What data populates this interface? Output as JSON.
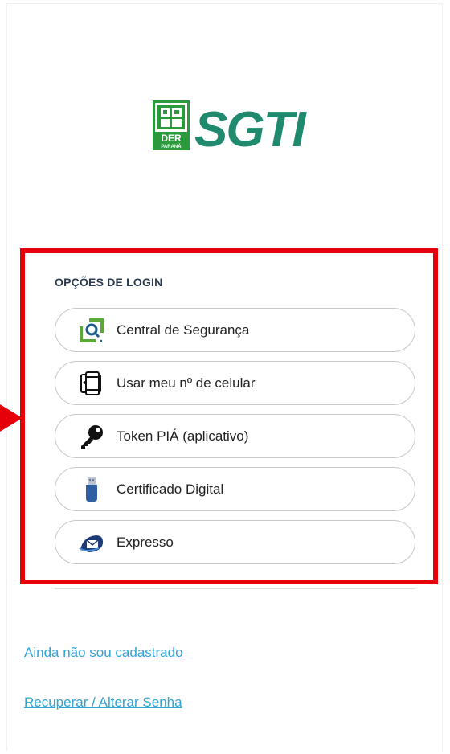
{
  "brand": {
    "logo_badge_text": "DER",
    "logo_badge_subtext": "PARANÁ",
    "app_name": "SGTI",
    "brand_green": "#1f8a6e",
    "badge_green": "#2a9a3c"
  },
  "login": {
    "section_title": "OPÇÕES DE LOGIN",
    "options": [
      {
        "label": "Central de Segurança",
        "icon": "central-seguranca-icon"
      },
      {
        "label": "Usar meu nº de celular",
        "icon": "cellphone-icon"
      },
      {
        "label": "Token PIÁ (aplicativo)",
        "icon": "key-icon"
      },
      {
        "label": "Certificado Digital",
        "icon": "usb-token-icon"
      },
      {
        "label": "Expresso",
        "icon": "expresso-mail-icon"
      }
    ]
  },
  "links": {
    "register": "Ainda não sou cadastrado",
    "recover_password": "Recuperar / Alterar Senha"
  },
  "annotation": {
    "highlight_color": "#e6000a"
  }
}
